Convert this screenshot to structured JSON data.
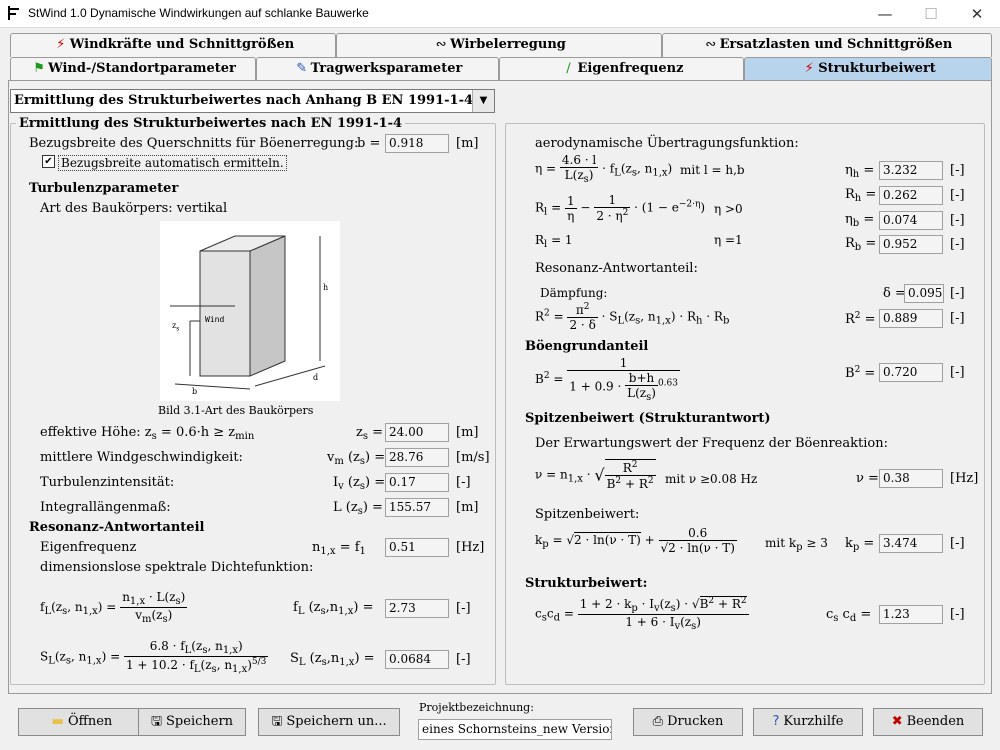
{
  "window": {
    "title": "StWind 1.0   Dynamische Windwirkungen auf schlanke Bauwerke",
    "minimize": "—",
    "maximize": "☐",
    "close": "✕"
  },
  "tabs_top": [
    {
      "label": "Windkräfte und Schnittgrößen",
      "icon": "⚡"
    },
    {
      "label": "Wirbelerregung",
      "icon": "∾"
    },
    {
      "label": "Ersatzlasten und Schnittgrößen",
      "icon": "∾"
    }
  ],
  "tabs_bottom": [
    {
      "label": "Wind-/Standortparameter",
      "icon": "⚑"
    },
    {
      "label": "Tragwerksparameter",
      "icon": "✎"
    },
    {
      "label": "Eigenfrequenz",
      "icon": "∕"
    },
    {
      "label": "Strukturbeiwert",
      "icon": "⚡"
    }
  ],
  "dropdown": {
    "value": "Ermittlung des Strukturbeiwertes nach Anhang B EN 1991-1-4"
  },
  "left": {
    "legend": "Ermittlung des Strukturbeiwertes nach EN 1991-1-4",
    "bezug_label": "Bezugsbreite des Querschnitts für Böenerregung:",
    "b_sym": "b =",
    "b_val": "0.918",
    "b_unit": "[m]",
    "checkbox_label": "Bezugsbreite automatisch ermitteln.",
    "checkbox_mark": "✔",
    "turb_head": "Turbulenzparameter",
    "art_label": "Art des Baukörpers: vertikal",
    "img_h": "h",
    "img_z": "z",
    "img_s": "s",
    "img_wind": "Wind",
    "img_b": "b",
    "img_d": "d",
    "caption": "Bild 3.1-Art des Baukörpers",
    "eff_label": "effektive Höhe: z",
    "eff_sub": "s",
    "eff_rest": " = 0.6·h ≥ z",
    "eff_sub2": "min",
    "zs_sym": "z",
    "zs_sub": "s",
    "zs_eq": " =",
    "zs_val": "24.00",
    "zs_unit": "[m]",
    "vm_label": "mittlere Windgeschwindigkeit:",
    "vm_sym": "v",
    "vm_sub": "m",
    "vm_arg": " (z",
    "vm_arg_sub": "s",
    "vm_eq": ") =",
    "vm_val": "28.76",
    "vm_unit": "[m/s]",
    "iv_label": "Turbulenzintensität:",
    "iv_sym": "I",
    "iv_sub": "v",
    "iv_arg": " (z",
    "iv_arg_sub": "s",
    "iv_eq": ") =",
    "iv_val": "0.17",
    "iv_unit": "[-]",
    "l_label": "Integrallängenmaß:",
    "l_sym": "L (z",
    "l_sub": "s",
    "l_eq": ") =",
    "l_val": "155.57",
    "l_unit": "[m]",
    "res_head": "Resonanz-Antwortanteil",
    "eig_label": "Eigenfrequenz",
    "n_sym": "n",
    "n_sub": "1,x",
    "n_mid": " = f",
    "n_sub2": "1",
    "n_val": "0.51",
    "n_unit": "[Hz]",
    "spek_label": "dimensionslose spektrale Dichtefunktion:",
    "fl_lhs": "f",
    "fl_lhs_sub": "L",
    "fl_lhs_arg": "(z",
    "fl_lhs_arg_s": "s",
    ", n": ", n",
    "fl_n_sub": "1,x",
    "fl_eq": ") =",
    "fl_num": "n",
    "fl_num_sub": "1,x",
    "fl_num_rest": " · L(z",
    "fl_num_s": "s",
    "fl_num_end": ")",
    "fl_den": "v",
    "fl_den_sub": "m",
    "fl_den_rest": "(z",
    "fl_den_s": "s",
    "fl_den_end": ")",
    "fl_sym": "f",
    "fl_sym_sub": "L",
    "fl_sym_arg": " (z",
    "fl_sym_s": "s",
    "fl_sym_n": ",n",
    "fl_sym_n_sub": "1,x",
    "fl_sym_eq": ") =",
    "fl_val": "2.73",
    "fl_unit": "[-]",
    "sl_lhs": "S",
    "sl_lhs_sub": "L",
    "sl_lhs_arg": "(z",
    "sl_lhs_s": "s",
    "sl_lhs_n": ", n",
    "sl_lhs_n_sub": "1,x",
    "sl_lhs_eq": ") =",
    "sl_num": "6.8 · f",
    "sl_num_sub": "L",
    "sl_num_rest": "(z",
    "sl_num_s": "s",
    "sl_num_n": ", n",
    "sl_num_n_sub": "1,x",
    "sl_num_end": ")",
    "sl_den": "1 + 10.2 · f",
    "sl_den_sub": "L",
    "sl_den_rest": "(z",
    "sl_den_s": "s",
    "sl_den_n": ", n",
    "sl_den_n_sub": "1,x",
    "sl_den_end": ")",
    "sl_den_exp": "5/3",
    "sl_sym": "S",
    "sl_sym_sub": "L",
    "sl_sym_arg": " (z",
    "sl_sym_s": "s",
    "sl_sym_n": ",n",
    "sl_sym_n_sub": "1,x",
    "sl_sym_eq": ") =",
    "sl_val": "0.0684",
    "sl_unit": "[-]"
  },
  "right": {
    "aero_label": "aerodynamische Übertragungsfunktion:",
    "eta_lhs": "η =",
    "eta_num": "4.6 · l",
    "eta_den": "L(z",
    "eta_den_s": "s",
    "eta_den_end": ")",
    "eta_rest": "· f",
    "eta_rest_sub": "L",
    "eta_rest_arg": "(z",
    "eta_rest_s": "s",
    "eta_rest_n": ", n",
    "eta_rest_n_sub": "1,x",
    "eta_rest_end": ")",
    "eta_mit": "mit l = h,b",
    "etah_sym": "η",
    "etah_sub": "h",
    "etah_eq": " =",
    "etah_val": "3.232",
    "etah_unit": "[-]",
    "rh_sym": "R",
    "rh_sub": "h",
    "rh_eq": " =",
    "rh_val": "0.262",
    "rh_unit": "[-]",
    "etab_sym": "η",
    "etab_sub": "b",
    "etab_eq": " =",
    "etab_val": "0.074",
    "etab_unit": "[-]",
    "rb_sym": "R",
    "rb_sub": "b",
    "rb_eq": " =",
    "rb_val": "0.952",
    "rb_unit": "[-]",
    "rl_lhs": "R",
    "rl_lhs_sub": "l",
    "rl_eq": " =",
    "rl_f1n": "1",
    "rl_f1d": "η",
    "rl_minus": "−",
    "rl_f2n": "1",
    "rl_f2d": "2 · η",
    "rl_f2d_exp": "2",
    "rl_tail": "· (1 − e",
    "rl_tail_exp": "−2·η",
    "rl_tail_end": ")",
    "rl_cond1": "η >0",
    "rl2_lhs": "R",
    "rl2_lhs_sub": "l",
    "rl2_rest": " = 1",
    "rl_cond2": "η =1",
    "reso_label": "Resonanz-Antwortanteil:",
    "daempf_label": "Dämpfung:",
    "delta_sym": "δ =",
    "delta_val": "0.095",
    "delta_unit": "[-]",
    "r2_lhs": "R",
    "r2_lhs_exp": "2",
    "r2_eq": " =",
    "r2_num": "π",
    "r2_num_exp": "2",
    "r2_den": "2 · δ",
    "r2_rest": "· S",
    "r2_rest_sub": "L",
    "r2_rest_arg": "(z",
    "r2_rest_s": "s",
    "r2_rest_n": ", n",
    "r2_rest_n_sub": "1,x",
    "r2_rest_end": ") · R",
    "r2_rh": "h",
    "r2_dot": " · R",
    "r2_rb": "b",
    "r2_sym": "R",
    "r2_sym_exp": "2",
    "r2_sym_eq": " =",
    "r2_val": "0.889",
    "r2_unit": "[-]",
    "boen_head": "Böengrundanteil",
    "b2_lhs": "B",
    "b2_lhs_exp": "2",
    "b2_eq": " =",
    "b2_num": "1",
    "b2_den": "1 + 0.9 · ",
    "b2_fn": "b+h",
    "b2_fd": "L(z",
    "b2_fd_s": "s",
    "b2_fd_end": ")",
    "b2_exp": "0.63",
    "b2_sym": "B",
    "b2_sym_exp": "2",
    "b2_sym_eq": " =",
    "b2_val": "0.720",
    "b2_unit": "[-]",
    "spitz_head": "Spitzenbeiwert (Strukturantwort)",
    "erw_label": "Der Erwartungswert der Frequenz der Böenreaktion:",
    "nu_lhs": "ν = n",
    "nu_lhs_sub": "1,x",
    "nu_dot": " ·",
    "nu_num": "R",
    "nu_num_exp": "2",
    "nu_den": "B",
    "nu_den_exp": "2",
    "nu_den_rest": " + R",
    "nu_den_exp2": "2",
    "nu_mit": "mit  ν ≥0.08 Hz",
    "nu_sym": "ν =",
    "nu_val": "0.38",
    "nu_unit": "[Hz]",
    "sp_label": "Spitzenbeiwert:",
    "kp_lhs": "k",
    "kp_lhs_sub": "p",
    "kp_eq": " =",
    "kp_root": "2 · ln(ν · T)",
    "kp_plus": "+",
    "kp_fn": "0.6",
    "kp_fd": "2 · ln(ν · T)",
    "kp_mit": "mit k",
    "kp_mit_sub": "p",
    "kp_mit_rest": " ≥ 3",
    "kp_sym": "k",
    "kp_sym_sub": "p",
    "kp_sym_eq": " =",
    "kp_val": "3.474",
    "kp_unit": "[-]",
    "struk_head": "Strukturbeiwert:",
    "cs_lhs": "c",
    "cs_lhs_sub": "s",
    "cs_lhs2": "c",
    "cs_lhs_sub2": "d",
    "cs_eq": " =",
    "cs_num": "1 + 2 · k",
    "cs_num_sub": "p",
    "cs_num_rest": " · I",
    "cs_num_sub2": "v",
    "cs_num_arg": "(z",
    "cs_num_s": "s",
    "cs_num_end": ") ·",
    "cs_num_root": "B",
    "cs_num_root_exp": "2",
    "cs_num_root_rest": " + R",
    "cs_num_root_exp2": "2",
    "cs_den": "1 + 6 · I",
    "cs_den_sub": "v",
    "cs_den_arg": "(z",
    "cs_den_s": "s",
    "cs_den_end": ")",
    "cs_sym": "c",
    "cs_sym_sub": "s",
    "cs_sym2": " c",
    "cs_sym_sub2": "d",
    "cs_sym_eq": " =",
    "cs_val": "1.23",
    "cs_unit": "[-]"
  },
  "bottom": {
    "open": "Öffnen",
    "save": "Speichern",
    "saveas": "Speichern un...",
    "proj_label": "Projektbezeichnung:",
    "proj_val": "eines Schornsteins_new Version",
    "print": "Drucken",
    "help": "Kurzhilfe",
    "quit": "Beenden"
  },
  "colors": {
    "accent": "#b8d3ec",
    "folder": "#e8c04a",
    "quit_x": "#c00000",
    "help": "#2b55b5"
  }
}
